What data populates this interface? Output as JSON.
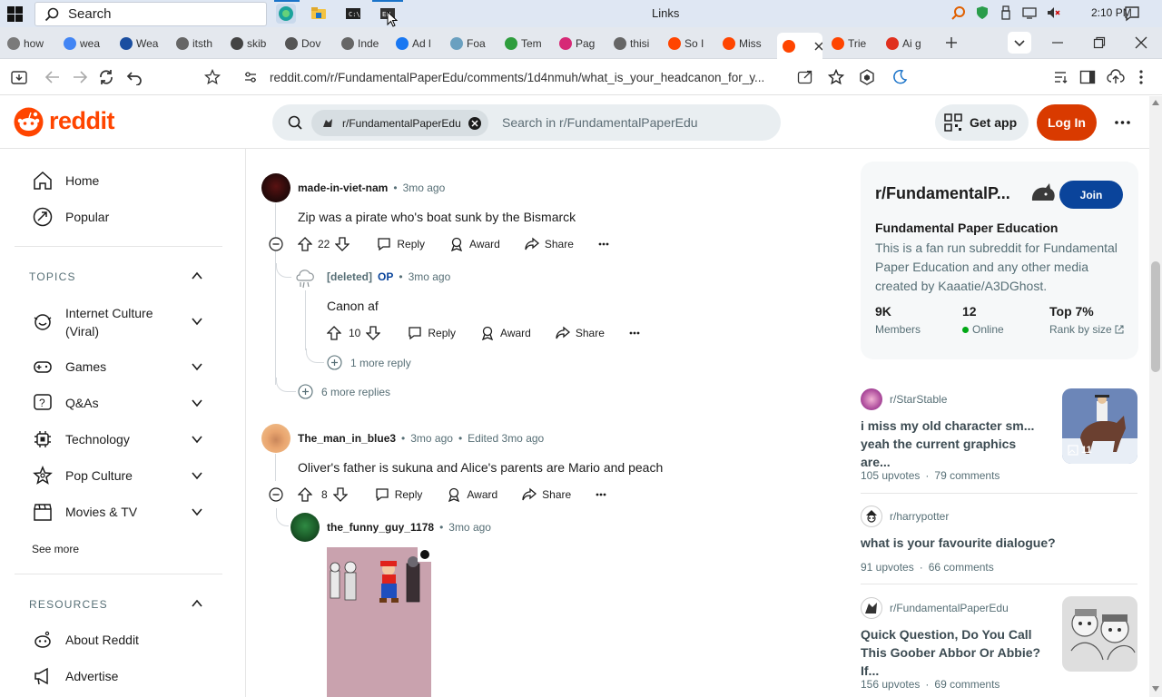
{
  "taskbar": {
    "search_label": "Search",
    "window_title": "Links",
    "clock": "2:10 PM"
  },
  "tabs": [
    {
      "label": "how",
      "color": "#7a7a7a"
    },
    {
      "label": "wea",
      "color": "#4285f4"
    },
    {
      "label": "Wea",
      "color": "#1a4ea0"
    },
    {
      "label": "itsth",
      "color": "#666"
    },
    {
      "label": "skib",
      "color": "#444"
    },
    {
      "label": "Dov",
      "color": "#555"
    },
    {
      "label": "Inde",
      "color": "#666"
    },
    {
      "label": "Ad l",
      "color": "#1877f2"
    },
    {
      "label": "Foa",
      "color": "#6aa0c0"
    },
    {
      "label": "Tem",
      "color": "#2e9d3d"
    },
    {
      "label": "Pag",
      "color": "#d62976"
    },
    {
      "label": "thisi",
      "color": "#666"
    },
    {
      "label": "So I",
      "color": "#ff4500"
    },
    {
      "label": "Miss",
      "color": "#ff4500"
    },
    {
      "label": "",
      "color": "#ff4500"
    },
    {
      "label": "Trie",
      "color": "#ff4500"
    },
    {
      "label": "Ai g",
      "color": "#e0301e"
    }
  ],
  "address": {
    "url": "reddit.com/r/FundamentalPaperEdu/comments/1d4nmuh/what_is_your_headcanon_for_y..."
  },
  "header": {
    "logo": "reddit",
    "subreddit_chip": "r/FundamentalPaperEdu",
    "search_placeholder": "Search in r/FundamentalPaperEdu",
    "get_app": "Get app",
    "login": "Log In"
  },
  "nav": {
    "home": "Home",
    "popular": "Popular",
    "topics_heading": "TOPICS",
    "topics": [
      "Internet Culture (Viral)",
      "Games",
      "Q&As",
      "Technology",
      "Pop Culture",
      "Movies & TV"
    ],
    "see_more": "See more",
    "resources_heading": "RESOURCES",
    "resources": [
      "About Reddit",
      "Advertise"
    ]
  },
  "comments": [
    {
      "user": "made-in-viet-nam",
      "time": "3mo ago",
      "text": "Zip was a pirate who's boat sunk by the Bismarck",
      "votes": "22"
    },
    {
      "user": "[deleted]",
      "op": "OP",
      "time": "3mo ago",
      "text": "Canon af",
      "votes": "10",
      "more": "1 more reply"
    },
    {
      "more": "6 more replies"
    },
    {
      "user": "The_man_in_blue3",
      "time": "3mo ago",
      "edited": "Edited 3mo ago",
      "text": "Oliver's father is sukuna and Alice's parents are Mario and peach",
      "votes": "8"
    },
    {
      "user": "the_funny_guy_1178",
      "time": "3mo ago"
    }
  ],
  "actions": {
    "reply": "Reply",
    "award": "Award",
    "share": "Share"
  },
  "subreddit": {
    "name": "r/FundamentalP...",
    "join": "Join",
    "title": "Fundamental Paper Education",
    "description": "This is a fan run subreddit for Fundamental Paper Education and any other media created by Kaaatie/A3DGhost.",
    "members_value": "9K",
    "members_label": "Members",
    "online_value": "12",
    "online_label": "Online",
    "rank_value": "Top 7%",
    "rank_label": "Rank by size"
  },
  "related": [
    {
      "sub": "r/StarStable",
      "title": "i miss my old character sm... yeah the current graphics are...",
      "upvotes": "105 upvotes",
      "comments": "79 comments",
      "badge": "11"
    },
    {
      "sub": "r/harrypotter",
      "title": "what is your favourite dialogue?",
      "upvotes": "91 upvotes",
      "comments": "66 comments"
    },
    {
      "sub": "r/FundamentalPaperEdu",
      "title": "Quick Question, Do You Call This Goober Abbor Or Abbie? If...",
      "upvotes": "156 upvotes",
      "comments": "69 comments"
    }
  ],
  "colors": {
    "brand": "#ff4500",
    "join": "#0a449b",
    "login": "#d93a00",
    "online_dot": "#01a816"
  }
}
